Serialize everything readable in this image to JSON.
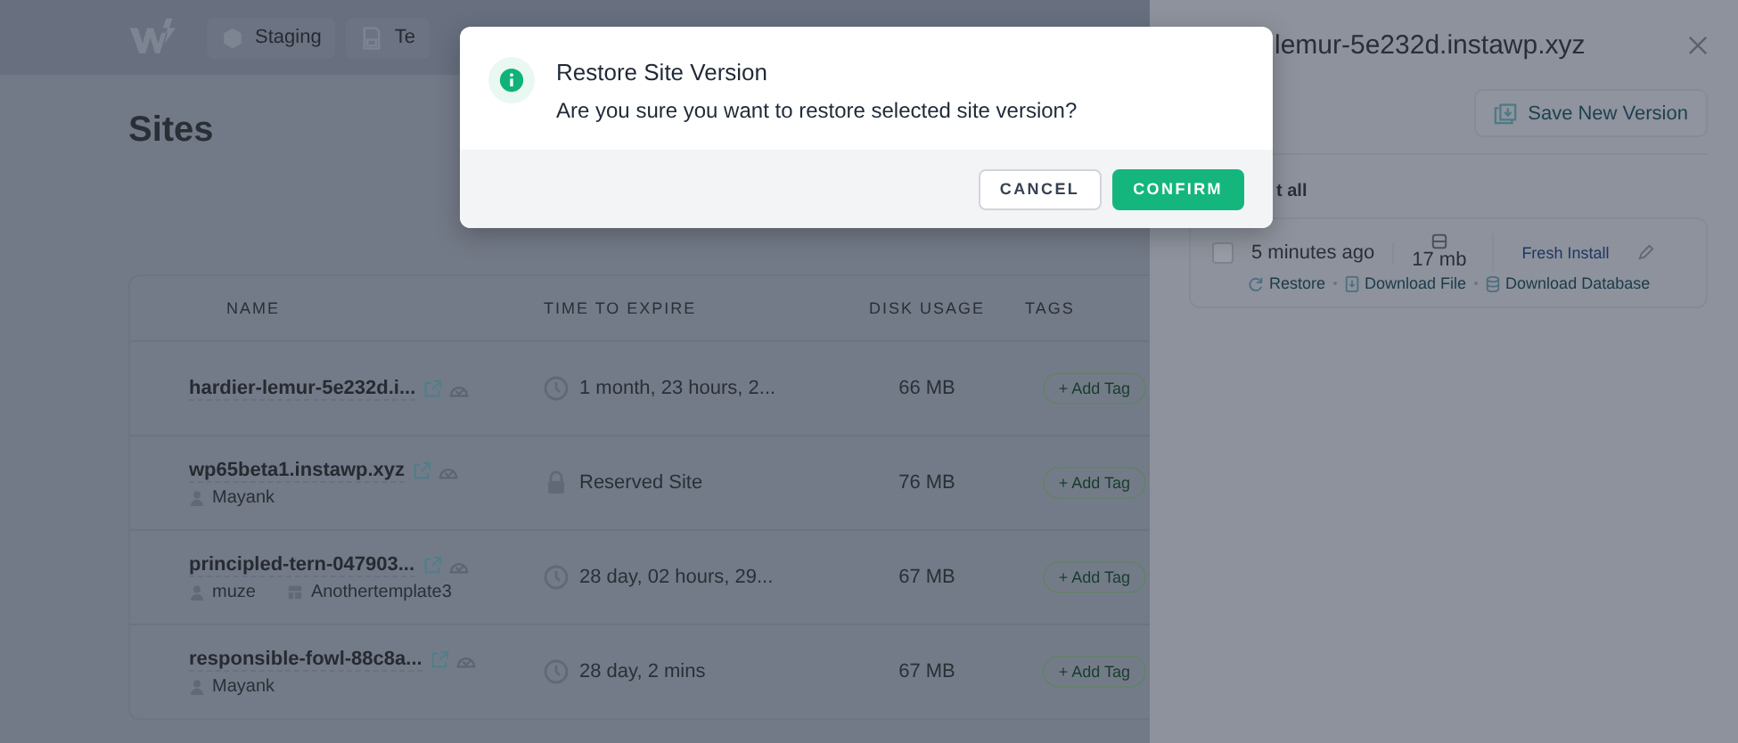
{
  "header": {
    "nav": [
      {
        "label": "Staging"
      },
      {
        "label": "Te"
      }
    ]
  },
  "page": {
    "title": "Sites"
  },
  "table": {
    "columns": [
      "NAME",
      "TIME TO EXPIRE",
      "DISK USAGE",
      "TAGS"
    ],
    "rows": [
      {
        "name": "hardier-lemur-5e232d.i...",
        "kind": "timer",
        "expiry": "1 month, 23 hours, 2...",
        "disk": "66 MB",
        "tag_button": "+ Add Tag"
      },
      {
        "name": "wp65beta1.instawp.xyz",
        "owner": "Mayank",
        "kind": "reserved",
        "expiry": "Reserved Site",
        "disk": "76 MB",
        "tag_button": "+ Add Tag"
      },
      {
        "name": "principled-tern-047903...",
        "owner": "muze",
        "template": "Anothertemplate3",
        "kind": "timer",
        "expiry": "28 day, 02 hours, 29...",
        "disk": "67 MB",
        "tag_button": "+ Add Tag"
      },
      {
        "name": "responsible-fowl-88c8a...",
        "owner": "Mayank",
        "kind": "timer",
        "expiry": "28 day, 2 mins",
        "disk": "67 MB",
        "tag_button": "+ Add Tag"
      }
    ]
  },
  "drawer": {
    "title": "lemur-5e232d.instawp.xyz",
    "save_button": "Save New Version",
    "select_all": "t all",
    "versions": [
      {
        "checked": false,
        "time": "5 minutes ago",
        "size": "17 mb",
        "label": "Fresh Install",
        "actions": [
          "Restore",
          "Download File",
          "Download Database"
        ]
      }
    ]
  },
  "modal": {
    "title": "Restore Site Version",
    "message": "Are you sure you want to restore selected site version?",
    "buttons": [
      {
        "label": "CANCEL",
        "kind": "secondary"
      },
      {
        "label": "CONFIRM",
        "kind": "primary"
      }
    ]
  }
}
